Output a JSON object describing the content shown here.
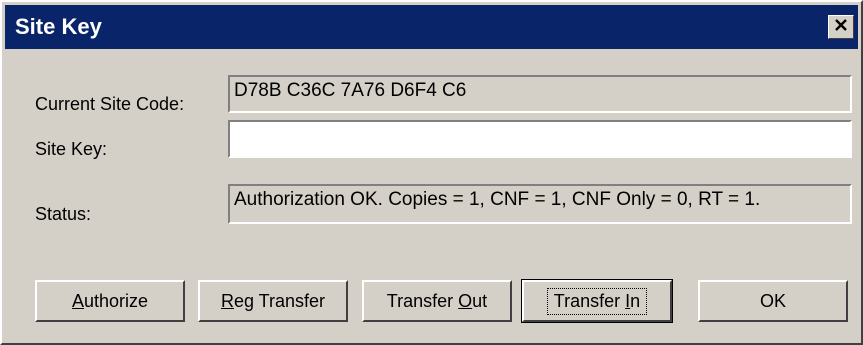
{
  "window": {
    "title": "Site Key",
    "close_icon": "close-icon"
  },
  "labels": {
    "current_site_code": "Current Site Code:",
    "site_key": "Site Key:",
    "status": "Status:"
  },
  "fields": {
    "current_site_code": "D78B C36C 7A76 D6F4 C6",
    "site_key": "",
    "status": "Authorization OK. Copies = 1, CNF = 1, CNF Only = 0, RT = 1."
  },
  "buttons": {
    "authorize": {
      "prefix": "",
      "mnemonic": "A",
      "suffix": "uthorize"
    },
    "reg_transfer": {
      "prefix": "",
      "mnemonic": "R",
      "suffix": "eg Transfer"
    },
    "transfer_out": {
      "prefix": "Transfer ",
      "mnemonic": "O",
      "suffix": "ut"
    },
    "transfer_in": {
      "prefix": "Transfer ",
      "mnemonic": "I",
      "suffix": "n"
    },
    "ok": {
      "label": "OK"
    }
  },
  "colors": {
    "titlebar": "#0a246a",
    "face": "#d4d0c8"
  }
}
